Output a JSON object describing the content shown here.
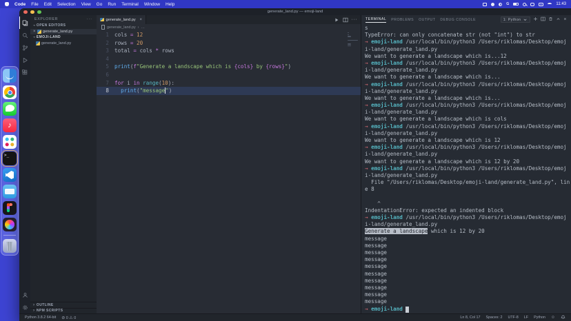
{
  "menubar": {
    "app_name": "Code",
    "menus": [
      "File",
      "Edit",
      "Selection",
      "View",
      "Go",
      "Run",
      "Terminal",
      "Window",
      "Help"
    ],
    "time": "11:43"
  },
  "window": {
    "title": "generate_land.py — emoji-land"
  },
  "dock": {
    "items": [
      "finder",
      "chrome",
      "messages",
      "music",
      "slack",
      "terminal",
      "vscode",
      "blue-app",
      "figma",
      "media-app",
      "trash"
    ],
    "music_glyph": "♪",
    "terminal_glyph": ">_"
  },
  "activity_bar": {
    "items": [
      "explorer",
      "search",
      "source-control",
      "run-debug",
      "extensions",
      "account",
      "settings"
    ]
  },
  "sidebar": {
    "title": "EXPLORER",
    "actions_glyph": "···",
    "open_editors_label": "OPEN EDITORS",
    "open_editor_file": "generate_land.py",
    "close_glyph": "×",
    "folder_label": "EMOJI-LAND",
    "file": "generate_land.py",
    "outline_label": "OUTLINE",
    "npm_label": "NPM SCRIPTS"
  },
  "editor": {
    "tab_label": "generate_land.py",
    "tab_close_glyph": "×",
    "more_glyph": "···",
    "breadcrumb_file": "generate_land.py",
    "breadcrumb_sep": "›",
    "breadcrumb_more": "…",
    "lines": [
      {
        "n": "1",
        "t": [
          [
            "v",
            "cols"
          ],
          [
            "o",
            " = "
          ],
          [
            "n",
            "12"
          ]
        ]
      },
      {
        "n": "2",
        "t": [
          [
            "v",
            "rows"
          ],
          [
            "o",
            " = "
          ],
          [
            "n",
            "20"
          ]
        ]
      },
      {
        "n": "3",
        "t": [
          [
            "v",
            "total"
          ],
          [
            "o",
            " = "
          ],
          [
            "v",
            "cols"
          ],
          [
            "o",
            " * "
          ],
          [
            "v",
            "rows"
          ]
        ]
      },
      {
        "n": "4",
        "t": []
      },
      {
        "n": "5",
        "t": [
          [
            "f",
            "print"
          ],
          [
            "p",
            "("
          ],
          [
            "k",
            "f"
          ],
          [
            "s",
            "\"Generate a landscape which is "
          ],
          [
            "i",
            "{cols}"
          ],
          [
            "s",
            " by "
          ],
          [
            "i",
            "{rows}"
          ],
          [
            "s",
            "\""
          ],
          [
            "p",
            ")"
          ]
        ]
      },
      {
        "n": "6",
        "t": []
      },
      {
        "n": "7",
        "t": [
          [
            "k",
            "for"
          ],
          [
            "p",
            " "
          ],
          [
            "v",
            "i"
          ],
          [
            "k",
            " in "
          ],
          [
            "b",
            "range"
          ],
          [
            "p",
            "("
          ],
          [
            "n",
            "10"
          ],
          [
            "p",
            "):"
          ]
        ]
      },
      {
        "n": "8",
        "current": true,
        "t": [
          [
            "p",
            "  "
          ],
          [
            "f",
            "print"
          ],
          [
            "p",
            "("
          ],
          [
            "s",
            "\"message"
          ],
          [
            "cursor",
            ""
          ],
          [
            "s",
            "\""
          ],
          [
            "p",
            ")"
          ]
        ]
      }
    ]
  },
  "panel": {
    "tabs": [
      "TERMINAL",
      "PROBLEMS",
      "OUTPUT",
      "DEBUG CONSOLE"
    ],
    "shell_selector": "1: Python",
    "close_glyph": "×"
  },
  "terminal": {
    "lines": [
      [
        [
          "p",
          "s"
        ]
      ],
      [
        [
          "p",
          "TypeError: can only concatenate str (not \"int\") to str"
        ]
      ],
      [
        [
          "a",
          "→ "
        ],
        [
          "h",
          "emoji-land"
        ],
        [
          "p",
          " /usr/local/bin/python3 /Users/riklomas/Desktop/emoj"
        ]
      ],
      [
        [
          "p",
          "i-land/generate_land.py"
        ]
      ],
      [
        [
          "p",
          "We want to generate a landscape which is...12"
        ]
      ],
      [
        [
          "a",
          "→ "
        ],
        [
          "h",
          "emoji-land"
        ],
        [
          "p",
          " /usr/local/bin/python3 /Users/riklomas/Desktop/emoj"
        ]
      ],
      [
        [
          "p",
          "i-land/generate_land.py"
        ]
      ],
      [
        [
          "p",
          "We want to generate a landscape which is..."
        ]
      ],
      [
        [
          "a",
          "→ "
        ],
        [
          "h",
          "emoji-land"
        ],
        [
          "p",
          " /usr/local/bin/python3 /Users/riklomas/Desktop/emoj"
        ]
      ],
      [
        [
          "p",
          "i-land/generate_land.py"
        ]
      ],
      [
        [
          "p",
          "We want to generate a landscape which is..."
        ]
      ],
      [
        [
          "a",
          "→ "
        ],
        [
          "h",
          "emoji-land"
        ],
        [
          "p",
          " /usr/local/bin/python3 /Users/riklomas/Desktop/emoj"
        ]
      ],
      [
        [
          "p",
          "i-land/generate_land.py"
        ]
      ],
      [
        [
          "p",
          "We want to generate a landscape which is cols"
        ]
      ],
      [
        [
          "a",
          "→ "
        ],
        [
          "h",
          "emoji-land"
        ],
        [
          "p",
          " /usr/local/bin/python3 /Users/riklomas/Desktop/emoj"
        ]
      ],
      [
        [
          "p",
          "i-land/generate_land.py"
        ]
      ],
      [
        [
          "p",
          "We want to generate a landscape which is 12"
        ]
      ],
      [
        [
          "a",
          "→ "
        ],
        [
          "h",
          "emoji-land"
        ],
        [
          "p",
          " /usr/local/bin/python3 /Users/riklomas/Desktop/emoj"
        ]
      ],
      [
        [
          "p",
          "i-land/generate_land.py"
        ]
      ],
      [
        [
          "p",
          "We want to generate a landscape which is 12 by 20"
        ]
      ],
      [
        [
          "a",
          "→ "
        ],
        [
          "h",
          "emoji-land"
        ],
        [
          "p",
          " /usr/local/bin/python3 /Users/riklomas/Desktop/emoj"
        ]
      ],
      [
        [
          "p",
          "i-land/generate_land.py"
        ]
      ],
      [
        [
          "p",
          "  File \"/Users/riklomas/Desktop/emoji-land/generate_land.py\", lin"
        ]
      ],
      [
        [
          "p",
          "e 8"
        ]
      ],
      [
        [
          "p",
          ""
        ]
      ],
      [
        [
          "p",
          "    ^"
        ]
      ],
      [
        [
          "p",
          "IndentationError: expected an indented block"
        ]
      ],
      [
        [
          "a",
          "→ "
        ],
        [
          "h",
          "emoji-land"
        ],
        [
          "p",
          " /usr/local/bin/python3 /Users/riklomas/Desktop/emoj"
        ]
      ],
      [
        [
          "p",
          "i-land/generate_land.py"
        ]
      ],
      [
        [
          "sel",
          "Generate a landscape"
        ],
        [
          "p",
          " which is 12 by 20"
        ]
      ],
      [
        [
          "p",
          "message"
        ]
      ],
      [
        [
          "p",
          "message"
        ]
      ],
      [
        [
          "p",
          "message"
        ]
      ],
      [
        [
          "p",
          "message"
        ]
      ],
      [
        [
          "p",
          "message"
        ]
      ],
      [
        [
          "p",
          "message"
        ]
      ],
      [
        [
          "p",
          "message"
        ]
      ],
      [
        [
          "p",
          "message"
        ]
      ],
      [
        [
          "p",
          "message"
        ]
      ],
      [
        [
          "p",
          "message"
        ]
      ],
      [
        [
          "a",
          "→ "
        ],
        [
          "h",
          "emoji-land"
        ],
        [
          "p",
          " "
        ],
        [
          "cur",
          " "
        ]
      ]
    ]
  },
  "statusbar": {
    "python_version": "Python 3.8.2 64-bit",
    "errors_glyph": "⊘",
    "errors": "0",
    "warnings_glyph": "⚠",
    "warnings": "0",
    "cursor_position": "Ln 8, Col 17",
    "indentation": "Spaces: 2",
    "encoding": "UTF-8",
    "eol": "LF",
    "language": "Python",
    "feedback_glyph": "☺"
  },
  "colors": {
    "wallpaper": "#3d44d3",
    "menubar": "#3037c4",
    "editor_bg": "#282c34",
    "sidebar_bg": "#21252b",
    "current_line": "#2e3a55",
    "keyword": "#c678dd",
    "string": "#98c379",
    "number": "#d19a66",
    "function": "#61afef",
    "builtin": "#56b6c2",
    "prompt_arrow": "#e06c75",
    "prompt_host": "#56b6c2"
  }
}
